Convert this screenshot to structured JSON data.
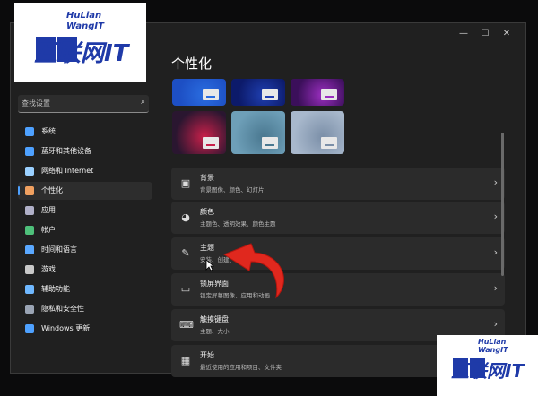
{
  "watermark": {
    "line1": "HuLian",
    "line2": "WangIT",
    "brand": "互联网IT"
  },
  "window": {
    "minimize": "—",
    "maximize": "☐",
    "close": "✕"
  },
  "search": {
    "placeholder": "查找设置"
  },
  "nav": {
    "items": [
      {
        "label": "系统",
        "icon": "monitor-icon",
        "color": "#4ea1ff"
      },
      {
        "label": "蓝牙和其他设备",
        "icon": "bluetooth-icon",
        "color": "#4ea1ff"
      },
      {
        "label": "网络和 Internet",
        "icon": "wifi-icon",
        "color": "#9ad0ff"
      },
      {
        "label": "个性化",
        "icon": "pen-icon",
        "color": "#f0a060",
        "selected": true
      },
      {
        "label": "应用",
        "icon": "apps-icon",
        "color": "#b0b0c8"
      },
      {
        "label": "帐户",
        "icon": "person-icon",
        "color": "#4ec07a"
      },
      {
        "label": "时间和语言",
        "icon": "globe-clock-icon",
        "color": "#5aa8ff"
      },
      {
        "label": "游戏",
        "icon": "gamepad-icon",
        "color": "#c8c8c8"
      },
      {
        "label": "辅助功能",
        "icon": "accessibility-icon",
        "color": "#6fb8ff"
      },
      {
        "label": "隐私和安全性",
        "icon": "shield-icon",
        "color": "#9aa4b4"
      },
      {
        "label": "Windows 更新",
        "icon": "update-icon",
        "color": "#4ea1ff"
      }
    ]
  },
  "page": {
    "title": "个性化"
  },
  "themes": [
    {
      "name": "theme-bloom-blue",
      "bg": "#1d4fc4",
      "accent": "#2a6de0"
    },
    {
      "name": "theme-bloom-dark",
      "bg": "#0c1a6a",
      "accent": "#1f3fb0"
    },
    {
      "name": "theme-glow-purple",
      "bg": "#3b0f5a",
      "accent": "#9b2fc0"
    },
    {
      "name": "theme-flower",
      "bg": "#2a1630",
      "accent": "#c8204a"
    },
    {
      "name": "theme-lake",
      "bg": "#6e9fb8",
      "accent": "#4a7890"
    },
    {
      "name": "theme-bloom-light",
      "bg": "#a8b8cc",
      "accent": "#7b8fa8"
    }
  ],
  "cards": [
    {
      "title": "背景",
      "subtitle": "背景图像、颜色、幻灯片",
      "icon": "image-icon"
    },
    {
      "title": "颜色",
      "subtitle": "主题色、透明效果、颜色主题",
      "icon": "palette-icon"
    },
    {
      "title": "主题",
      "subtitle": "安装、创建、管理",
      "icon": "brush-icon"
    },
    {
      "title": "锁屏界面",
      "subtitle": "锁定屏幕图像、应用和动画",
      "icon": "lock-screen-icon"
    },
    {
      "title": "触摸键盘",
      "subtitle": "主题、大小",
      "icon": "keyboard-icon"
    },
    {
      "title": "开始",
      "subtitle": "最近使用的应用和项目、文件夹",
      "icon": "start-icon"
    }
  ],
  "annotation": {
    "color": "#e0281e"
  }
}
